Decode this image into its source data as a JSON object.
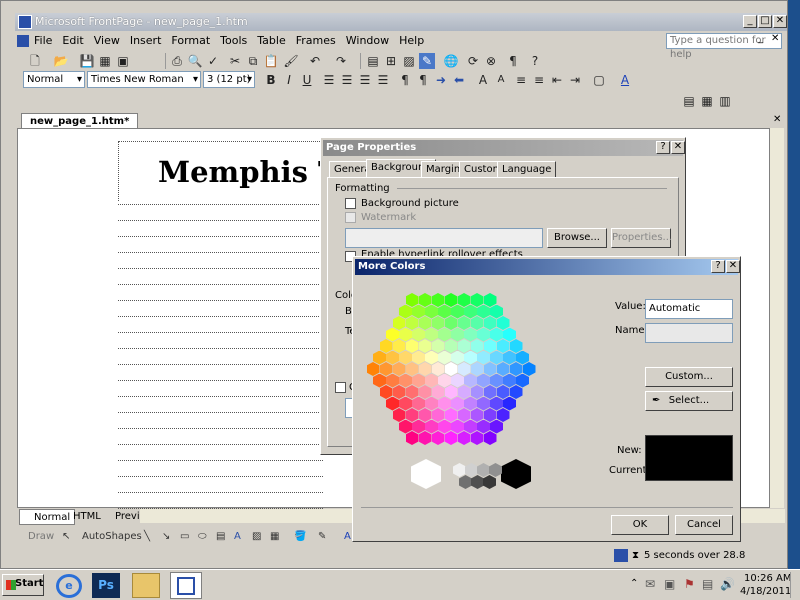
{
  "app": {
    "title": "Microsoft FrontPage - new_page_1.htm",
    "help_placeholder": "Type a question for help",
    "menu": [
      "File",
      "Edit",
      "View",
      "Insert",
      "Format",
      "Tools",
      "Table",
      "Frames",
      "Window",
      "Help"
    ],
    "style_value": "Normal",
    "font_value": "Times New Roman",
    "size_value": "3  (12 pt)",
    "doc_tab": "new_page_1.htm*",
    "heading": "Memphis Te",
    "view_tabs": [
      "Normal",
      "HTML",
      "Preview"
    ],
    "draw_label": "Draw",
    "autoshapes_label": "AutoShapes",
    "status_text": "5 seconds over 28.8"
  },
  "page_properties": {
    "title": "Page Properties",
    "tabs": [
      "General",
      "Background",
      "Margins",
      "Custom",
      "Language"
    ],
    "active_tab": "Background",
    "formatting_label": "Formatting",
    "bg_picture_label": "Background picture",
    "watermark_label": "Watermark",
    "browse_label": "Browse...",
    "properties_label": "Properties...",
    "hyperlink_label": "Enable hyperlink rollover effects",
    "colors_label": "Colo",
    "ba_label": "Ba",
    "te_label": "Te",
    "g_label": "G"
  },
  "more_colors": {
    "title": "More Colors",
    "value_label": "Value:",
    "value": "Automatic",
    "name_label": "Name:",
    "custom_label": "Custom...",
    "select_label": "Select...",
    "new_label": "New:",
    "current_label": "Current:",
    "ok_label": "OK",
    "cancel_label": "Cancel",
    "current_color": "#000000"
  },
  "taskbar": {
    "start_label": "Start",
    "time": "10:26 AM",
    "date": "4/18/2011"
  }
}
